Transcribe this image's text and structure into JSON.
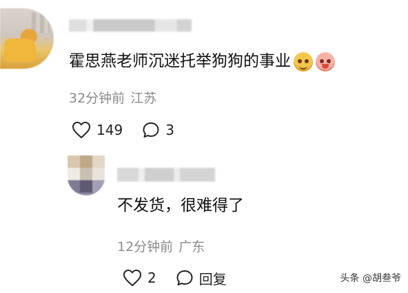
{
  "comment": {
    "text": "霍思燕老师沉迷托举狗狗的事业",
    "emojis": [
      "grin-face-emoji",
      "laughing-face-emoji"
    ],
    "time": "32分钟前",
    "location": "江苏",
    "likes": "149",
    "replies": "3"
  },
  "reply": {
    "text": "不发货，很难得了",
    "time": "12分钟前",
    "location": "广东",
    "likes": "2",
    "reply_label": "回复"
  },
  "watermark": "头条 @胡叁爷",
  "icons": {
    "like": "heart-outline-icon",
    "comment": "speech-bubble-outline-icon"
  }
}
